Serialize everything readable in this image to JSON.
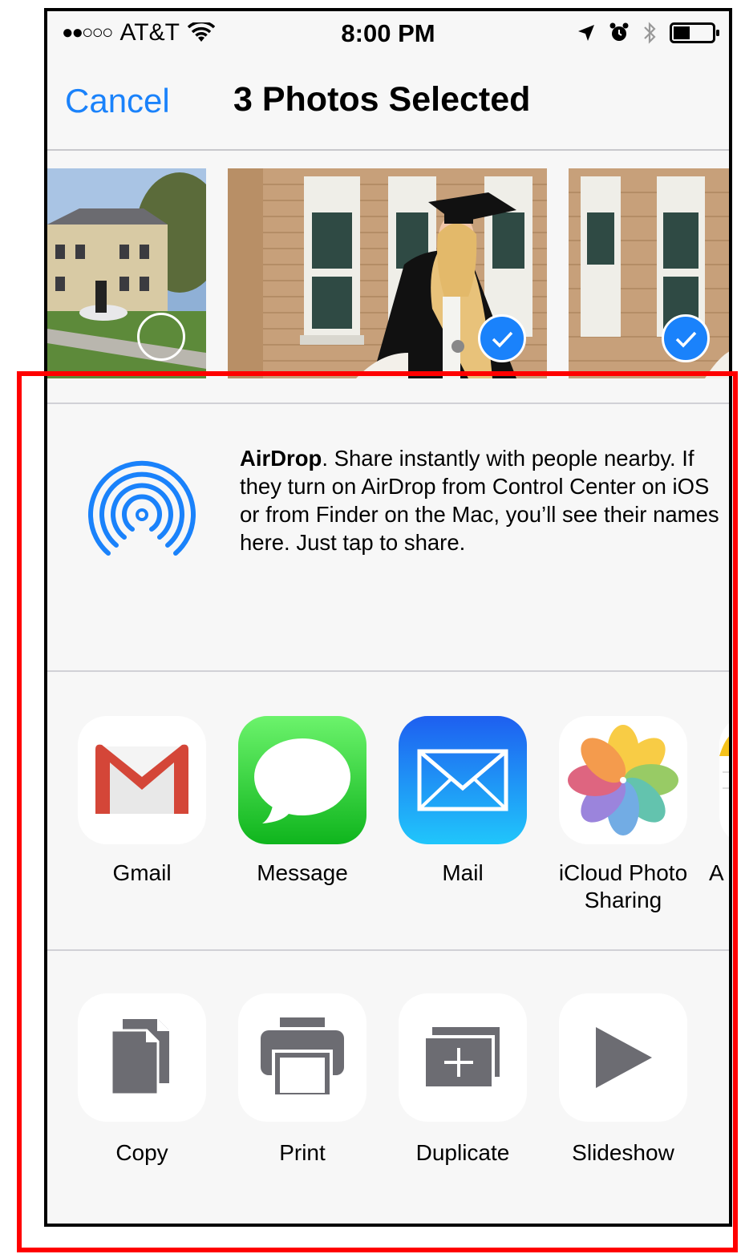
{
  "status_bar": {
    "signal": "●●○○○",
    "carrier": "AT&T",
    "time": "8:00 PM"
  },
  "nav": {
    "cancel_label": "Cancel",
    "title": "3 Photos Selected"
  },
  "photos": [
    {
      "name": "photo-1",
      "selected": false
    },
    {
      "name": "photo-2",
      "selected": true
    },
    {
      "name": "photo-3",
      "selected": true
    }
  ],
  "airdrop": {
    "title": "AirDrop",
    "description": ". Share instantly with people nearby. If they turn on AirDrop from Control Center on iOS or from Finder on the Mac, you’ll see their names here. Just tap to share."
  },
  "share_apps": [
    {
      "label": "Gmail",
      "icon": "gmail-icon"
    },
    {
      "label": "Message",
      "icon": "messages-icon"
    },
    {
      "label": "Mail",
      "icon": "mail-icon"
    },
    {
      "label": "iCloud Photo Sharing",
      "icon": "photos-icon"
    },
    {
      "label": "A",
      "icon": "app-icon"
    }
  ],
  "actions": [
    {
      "label": "Copy",
      "icon": "copy-icon"
    },
    {
      "label": "Print",
      "icon": "print-icon"
    },
    {
      "label": "Duplicate",
      "icon": "duplicate-icon"
    },
    {
      "label": "Slideshow",
      "icon": "play-icon"
    }
  ],
  "colors": {
    "accent": "#1a82fb",
    "sheet_bg": "#f7f7f7",
    "annotation": "#ff0000"
  }
}
